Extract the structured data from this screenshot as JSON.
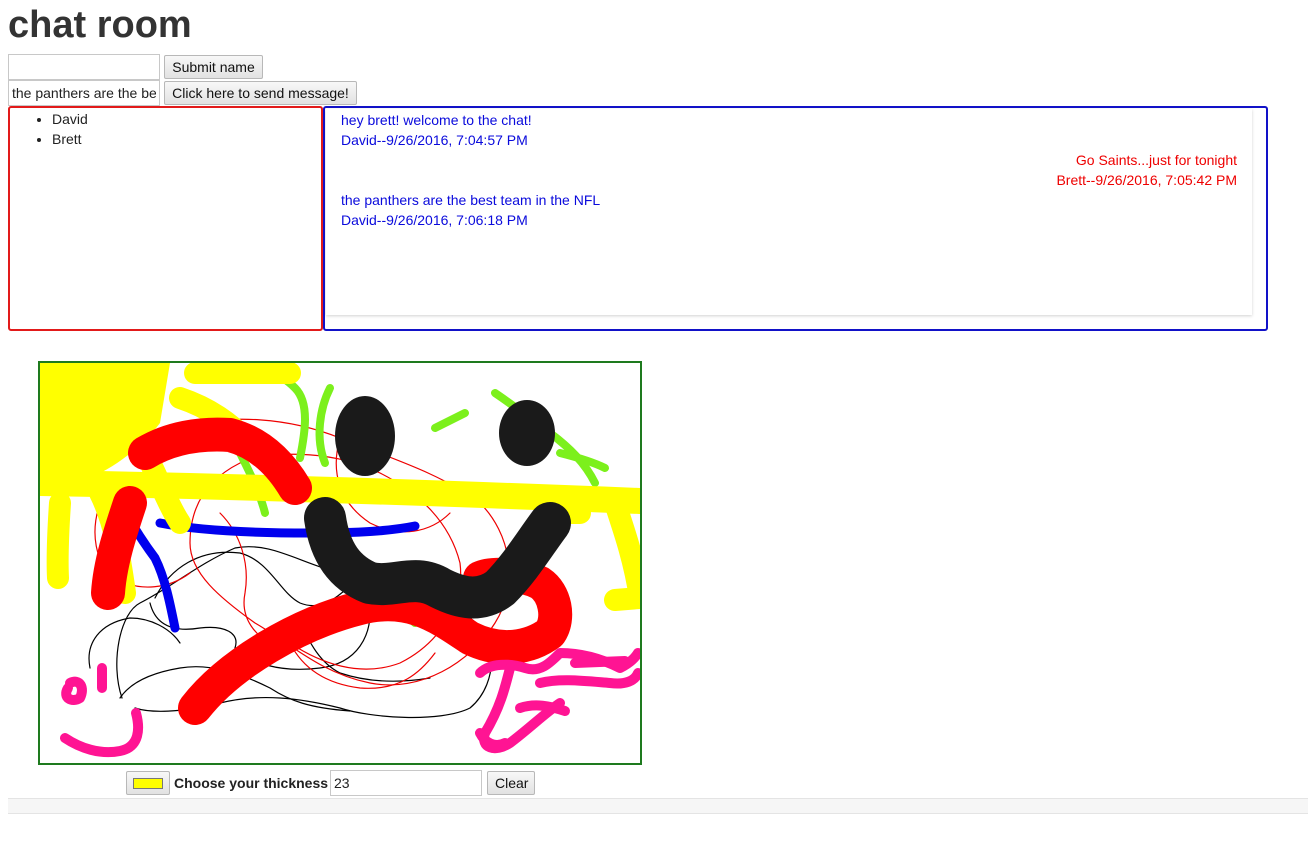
{
  "page": {
    "title": "chat room"
  },
  "name_form": {
    "name_value": "",
    "submit_label": "Submit name"
  },
  "message_form": {
    "message_value": "the panthers are the best team in the NFL",
    "send_label": "Click here to send message!"
  },
  "users": [
    "David",
    "Brett"
  ],
  "messages": [
    {
      "text": "hey brett! welcome to the chat!",
      "meta": "David--9/26/2016, 7:04:57 PM",
      "side": "left",
      "color": "#0a0adc"
    },
    {
      "text": "Go Saints...just for tonight",
      "meta": "Brett--9/26/2016, 7:05:42 PM",
      "side": "right",
      "color": "#ee0000"
    },
    {
      "text": "the panthers are the best team in the NFL",
      "meta": "David--9/26/2016, 7:06:18 PM",
      "side": "left",
      "color": "#0a0adc"
    }
  ],
  "drawing_tools": {
    "selected_color": "#ffff00",
    "thickness_label": "Choose your thickness",
    "thickness_value": "23",
    "clear_label": "Clear"
  },
  "colors": {
    "users_border": "#e21a1a",
    "chat_border": "#1212c8",
    "canvas_border": "#1e7a1e",
    "stroke_colors": [
      "#ffff00",
      "#ff0000",
      "#000000",
      "#1a1a1a",
      "#0000ee",
      "#7cf01c",
      "#ff1493"
    ]
  }
}
